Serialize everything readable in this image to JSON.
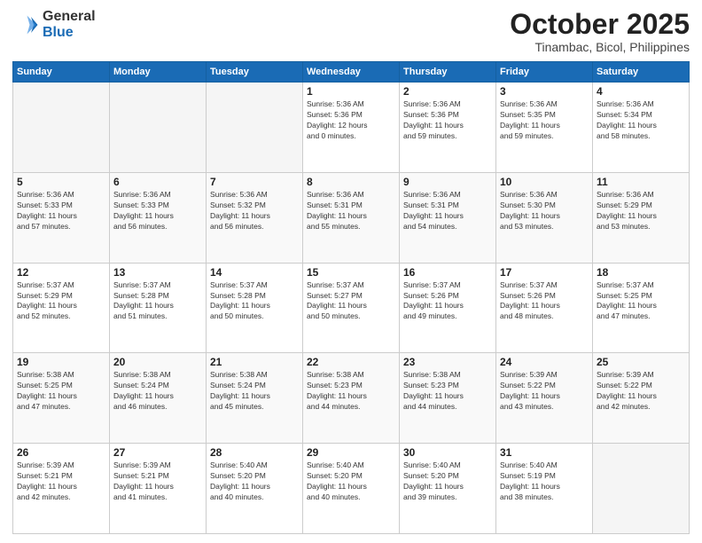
{
  "header": {
    "logo_general": "General",
    "logo_blue": "Blue",
    "month_title": "October 2025",
    "location": "Tinambac, Bicol, Philippines"
  },
  "weekdays": [
    "Sunday",
    "Monday",
    "Tuesday",
    "Wednesday",
    "Thursday",
    "Friday",
    "Saturday"
  ],
  "weeks": [
    [
      {
        "day": "",
        "info": ""
      },
      {
        "day": "",
        "info": ""
      },
      {
        "day": "",
        "info": ""
      },
      {
        "day": "1",
        "info": "Sunrise: 5:36 AM\nSunset: 5:36 PM\nDaylight: 12 hours\nand 0 minutes."
      },
      {
        "day": "2",
        "info": "Sunrise: 5:36 AM\nSunset: 5:36 PM\nDaylight: 11 hours\nand 59 minutes."
      },
      {
        "day": "3",
        "info": "Sunrise: 5:36 AM\nSunset: 5:35 PM\nDaylight: 11 hours\nand 59 minutes."
      },
      {
        "day": "4",
        "info": "Sunrise: 5:36 AM\nSunset: 5:34 PM\nDaylight: 11 hours\nand 58 minutes."
      }
    ],
    [
      {
        "day": "5",
        "info": "Sunrise: 5:36 AM\nSunset: 5:33 PM\nDaylight: 11 hours\nand 57 minutes."
      },
      {
        "day": "6",
        "info": "Sunrise: 5:36 AM\nSunset: 5:33 PM\nDaylight: 11 hours\nand 56 minutes."
      },
      {
        "day": "7",
        "info": "Sunrise: 5:36 AM\nSunset: 5:32 PM\nDaylight: 11 hours\nand 56 minutes."
      },
      {
        "day": "8",
        "info": "Sunrise: 5:36 AM\nSunset: 5:31 PM\nDaylight: 11 hours\nand 55 minutes."
      },
      {
        "day": "9",
        "info": "Sunrise: 5:36 AM\nSunset: 5:31 PM\nDaylight: 11 hours\nand 54 minutes."
      },
      {
        "day": "10",
        "info": "Sunrise: 5:36 AM\nSunset: 5:30 PM\nDaylight: 11 hours\nand 53 minutes."
      },
      {
        "day": "11",
        "info": "Sunrise: 5:36 AM\nSunset: 5:29 PM\nDaylight: 11 hours\nand 53 minutes."
      }
    ],
    [
      {
        "day": "12",
        "info": "Sunrise: 5:37 AM\nSunset: 5:29 PM\nDaylight: 11 hours\nand 52 minutes."
      },
      {
        "day": "13",
        "info": "Sunrise: 5:37 AM\nSunset: 5:28 PM\nDaylight: 11 hours\nand 51 minutes."
      },
      {
        "day": "14",
        "info": "Sunrise: 5:37 AM\nSunset: 5:28 PM\nDaylight: 11 hours\nand 50 minutes."
      },
      {
        "day": "15",
        "info": "Sunrise: 5:37 AM\nSunset: 5:27 PM\nDaylight: 11 hours\nand 50 minutes."
      },
      {
        "day": "16",
        "info": "Sunrise: 5:37 AM\nSunset: 5:26 PM\nDaylight: 11 hours\nand 49 minutes."
      },
      {
        "day": "17",
        "info": "Sunrise: 5:37 AM\nSunset: 5:26 PM\nDaylight: 11 hours\nand 48 minutes."
      },
      {
        "day": "18",
        "info": "Sunrise: 5:37 AM\nSunset: 5:25 PM\nDaylight: 11 hours\nand 47 minutes."
      }
    ],
    [
      {
        "day": "19",
        "info": "Sunrise: 5:38 AM\nSunset: 5:25 PM\nDaylight: 11 hours\nand 47 minutes."
      },
      {
        "day": "20",
        "info": "Sunrise: 5:38 AM\nSunset: 5:24 PM\nDaylight: 11 hours\nand 46 minutes."
      },
      {
        "day": "21",
        "info": "Sunrise: 5:38 AM\nSunset: 5:24 PM\nDaylight: 11 hours\nand 45 minutes."
      },
      {
        "day": "22",
        "info": "Sunrise: 5:38 AM\nSunset: 5:23 PM\nDaylight: 11 hours\nand 44 minutes."
      },
      {
        "day": "23",
        "info": "Sunrise: 5:38 AM\nSunset: 5:23 PM\nDaylight: 11 hours\nand 44 minutes."
      },
      {
        "day": "24",
        "info": "Sunrise: 5:39 AM\nSunset: 5:22 PM\nDaylight: 11 hours\nand 43 minutes."
      },
      {
        "day": "25",
        "info": "Sunrise: 5:39 AM\nSunset: 5:22 PM\nDaylight: 11 hours\nand 42 minutes."
      }
    ],
    [
      {
        "day": "26",
        "info": "Sunrise: 5:39 AM\nSunset: 5:21 PM\nDaylight: 11 hours\nand 42 minutes."
      },
      {
        "day": "27",
        "info": "Sunrise: 5:39 AM\nSunset: 5:21 PM\nDaylight: 11 hours\nand 41 minutes."
      },
      {
        "day": "28",
        "info": "Sunrise: 5:40 AM\nSunset: 5:20 PM\nDaylight: 11 hours\nand 40 minutes."
      },
      {
        "day": "29",
        "info": "Sunrise: 5:40 AM\nSunset: 5:20 PM\nDaylight: 11 hours\nand 40 minutes."
      },
      {
        "day": "30",
        "info": "Sunrise: 5:40 AM\nSunset: 5:20 PM\nDaylight: 11 hours\nand 39 minutes."
      },
      {
        "day": "31",
        "info": "Sunrise: 5:40 AM\nSunset: 5:19 PM\nDaylight: 11 hours\nand 38 minutes."
      },
      {
        "day": "",
        "info": ""
      }
    ]
  ]
}
